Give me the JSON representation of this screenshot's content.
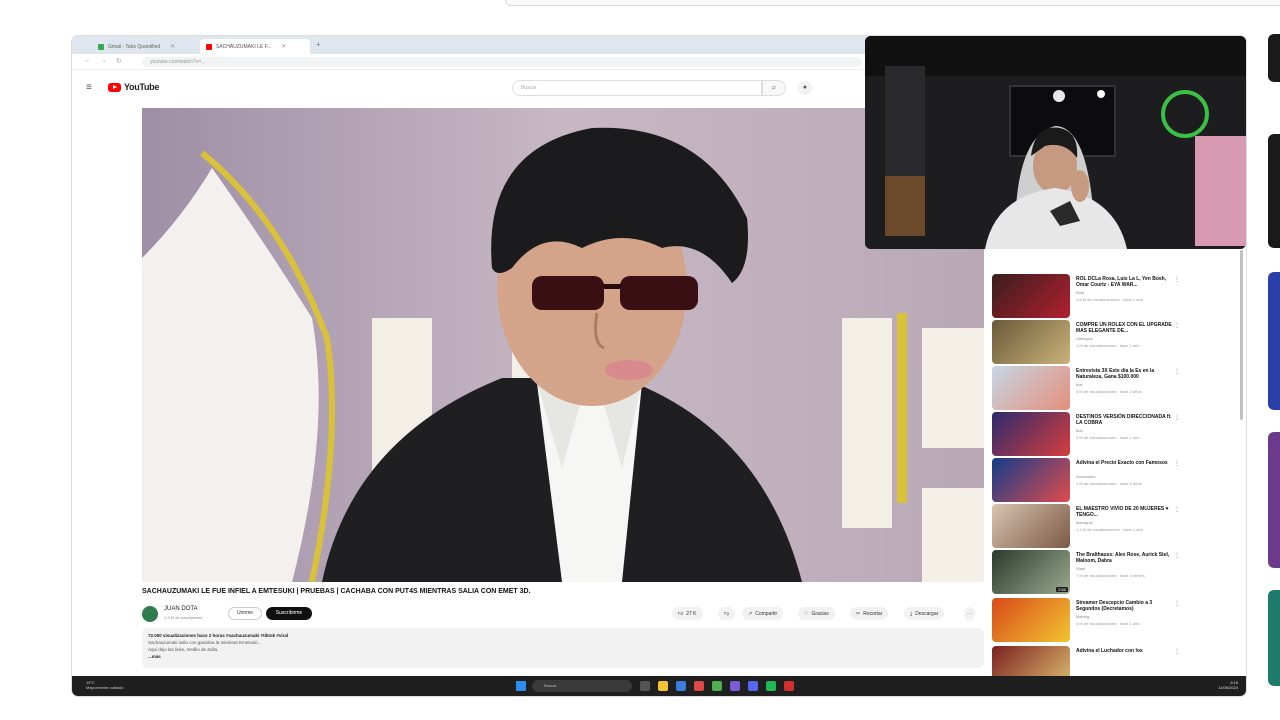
{
  "browser": {
    "tabs": [
      {
        "label": "Gmail - Tabs Quantified",
        "active": false,
        "favicon_color": "#34a853"
      },
      {
        "label": "SACHAUZUMAKI LE F...",
        "active": true,
        "favicon_color": "#ff0000"
      }
    ],
    "url": "youtube.com/watch?v=..."
  },
  "youtube": {
    "logo_text": "YouTube",
    "search_placeholder": "Buscar"
  },
  "video": {
    "title": "SACHAUZUMAKI LE FUE INFIEL A EMTESUKI | PRUEBAS | CACHABA CON PUT4S MIENTRAS SALIA CON EMET 3D.",
    "channel_name": "JUAN DOTA",
    "channel_subs": "2.3 M de suscriptores",
    "join_label": "Unirme",
    "subscribe_label": "Suscribirme",
    "likes": "27 K",
    "share_label": "Compartir",
    "thanks_label": "Gracias",
    "clip_label": "Recortar",
    "download_label": "Descargar",
    "description_lines": [
      "72.000 visualizaciones hace 2 horas #sachauzumaki #tiktok #viral",
      "Sachauzumaki salio con gasolina la mientras Emetsuki...",
      "Aqui dejo las links, medilo de Zulla.",
      "...más"
    ]
  },
  "sidebar": {
    "recommendations": [
      {
        "title": "ROL DCLa Rosa, Luis La L, Yen Bosh, Omar Courtz - EYA WAR...",
        "channel": "Rola",
        "meta": "4,8 M de visualizaciones · hace 1 año",
        "duration": "",
        "thumb_colors": [
          "#3a1d1d",
          "#b0202e"
        ]
      },
      {
        "title": "COMPRE UN ROLEX CON EL UPGRADE MAS ELEGANTE DE...",
        "channel": "Ulfmsyus",
        "meta": "1 M de visualizaciones · hace 1 año",
        "duration": "",
        "thumb_colors": [
          "#6b5a3a",
          "#c9b27a"
        ]
      },
      {
        "title": "Entrevista 3X Este día la Es en la Naturaleza, Gana $100.000",
        "channel": "Ibai",
        "meta": "5 M de visualizaciones · hace 2 años",
        "duration": "",
        "thumb_colors": [
          "#c8d6e6",
          "#e38f7a"
        ]
      },
      {
        "title": "DESTINOS VERSIÓN DIRECCIONADA ft. LA COBRA",
        "channel": "Ibai",
        "meta": "3 M de visualizaciones · hace 1 año",
        "duration": "",
        "thumb_colors": [
          "#2b2b6e",
          "#d63d3d"
        ]
      },
      {
        "title": "Adivina el Precio Exacto con Famosos",
        "channel": "Sordorsino",
        "meta": "2 M de visualizaciones · hace 6 años",
        "duration": "",
        "thumb_colors": [
          "#123c8a",
          "#e04c4c"
        ]
      },
      {
        "title": "EL MAESTRO VIVIO DE 20 MUJERES ♥ TENGO...",
        "channel": "Mariopoe",
        "meta": "1,1 M de visualizaciones · hace 1 año",
        "duration": "",
        "thumb_colors": [
          "#d9c4b0",
          "#7a5a45"
        ]
      },
      {
        "title": "The Bralthauss: Alex Rose, Aurick Stel, Maloom, Dabra",
        "channel": "Stark",
        "meta": "7 M de visualizaciones · hace 4 meses",
        "duration": "2:50",
        "thumb_colors": [
          "#2c3a2c",
          "#9aaa8e"
        ]
      },
      {
        "title": "Streamer Descepcio Cambio a 3 Segundos (Decretamos)",
        "channel": "Maldog",
        "meta": "4 M de visualizaciones · hace 1 año",
        "duration": "",
        "thumb_colors": [
          "#d84a1a",
          "#f2c431"
        ]
      },
      {
        "title": "Adivina el Luchador con los",
        "channel": "",
        "meta": "",
        "duration": "",
        "thumb_colors": [
          "#7a2020",
          "#e0c070"
        ]
      }
    ]
  },
  "taskbar": {
    "weather_temp": "19°C",
    "weather_desc": "Mayormente nublado",
    "search_placeholder": "Buscar",
    "time": "9:16",
    "date": "11/06/2024"
  },
  "icons": {
    "menu": "menu-icon",
    "search": "search-icon",
    "mic": "mic-icon",
    "like": "thumbs-up-icon",
    "dislike": "thumbs-down-icon",
    "share": "share-icon",
    "more": "more-icon"
  }
}
